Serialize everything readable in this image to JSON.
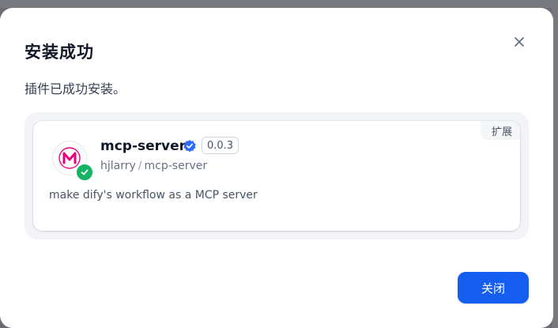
{
  "dialog": {
    "title": "安装成功",
    "message": "插件已成功安装。",
    "close_icon": "close-icon"
  },
  "plugin": {
    "icon_letter": "M",
    "name": "mcp-server",
    "version": "0.0.3",
    "org": "hjlarry",
    "separator": "/",
    "repo": "mcp-server",
    "description": "make dify's workflow as a MCP server",
    "category": "扩展",
    "verified_icon": "verified-badge-icon",
    "installed_icon": "check-circle-icon"
  },
  "actions": {
    "close_label": "关闭"
  },
  "colors": {
    "primary": "#155eef",
    "success": "#16b364",
    "icon_magenta": "#e6007e",
    "verified_blue": "#2f6bff"
  }
}
